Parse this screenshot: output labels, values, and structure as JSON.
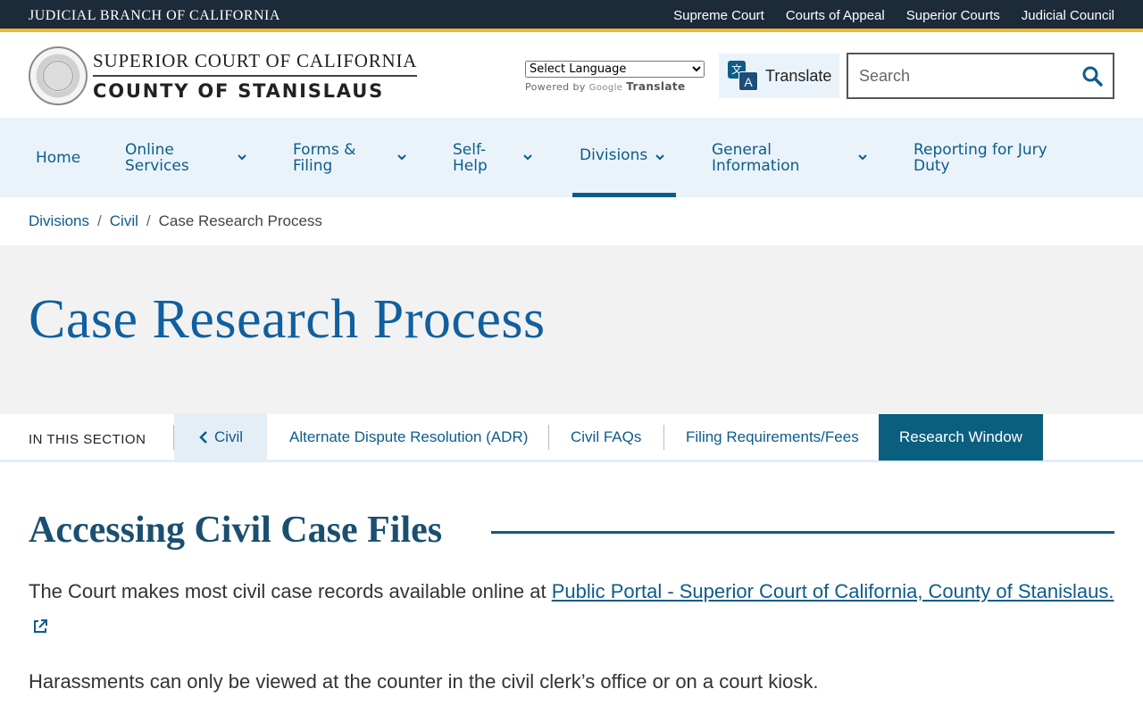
{
  "topbar": {
    "branch": "JUDICIAL BRANCH OF CALIFORNIA",
    "links": [
      "Supreme Court",
      "Courts of Appeal",
      "Superior Courts",
      "Judicial Council"
    ]
  },
  "header": {
    "court_line1": "SUPERIOR COURT OF CALIFORNIA",
    "court_line2": "COUNTY OF STANISLAUS",
    "language_select": "Select Language",
    "powered_by": "Powered by",
    "google": "Google",
    "translate_brand": "Translate",
    "translate_button": "Translate",
    "search_placeholder": "Search"
  },
  "nav": {
    "items": [
      {
        "label": "Home"
      },
      {
        "label": "Online Services"
      },
      {
        "label": "Forms & Filing"
      },
      {
        "label": "Self-Help"
      },
      {
        "label": "Divisions"
      },
      {
        "label": "General Information"
      },
      {
        "label": "Reporting for Jury Duty"
      }
    ]
  },
  "breadcrumb": {
    "items": [
      "Divisions",
      "Civil"
    ],
    "current": "Case Research Process"
  },
  "page_title": "Case Research Process",
  "section_nav": {
    "label": "IN THIS SECTION",
    "back": "Civil",
    "tabs": [
      "Alternate Dispute Resolution (ADR)",
      "Civil FAQs",
      "Filing Requirements/Fees",
      "Research Window"
    ],
    "active_tab": "Research Window"
  },
  "content": {
    "heading": "Accessing Civil Case Files",
    "para1_text": "The Court makes most civil case records available online at ",
    "para1_link": "Public Portal - Superior Court of California, County of Stanislaus.",
    "para2": "Harassments can only be viewed at the counter in the civil clerk’s office or on a court kiosk."
  },
  "colors": {
    "topbar_bg": "#1c2b3a",
    "accent_gold": "#f2b52b",
    "nav_bg": "#eaf3fa",
    "link_blue": "#0d5c8a",
    "active_tab_bg": "#0a5f7f",
    "title_blue": "#1060a0"
  }
}
